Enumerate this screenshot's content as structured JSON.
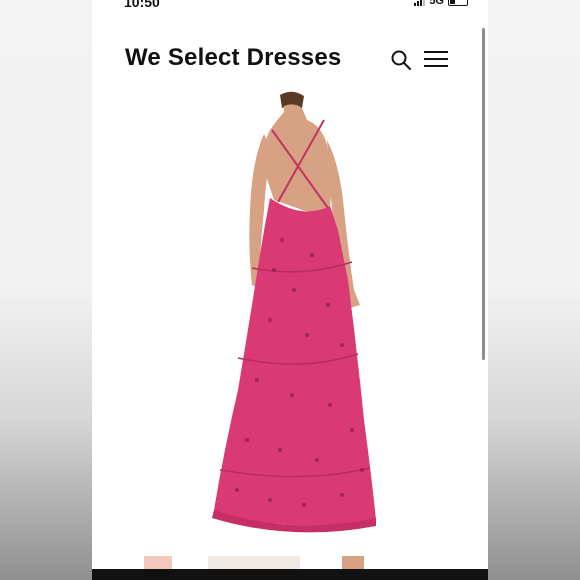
{
  "status_bar": {
    "time": "10:50",
    "network": "5G"
  },
  "header": {
    "title": "We Select Dresses",
    "search_icon": "search-icon",
    "menu_icon": "hamburger-menu-icon"
  },
  "product": {
    "image": "dress-image",
    "dress_color": "#d93a73"
  },
  "colors": {
    "background": "#ffffff",
    "text": "#111111",
    "accent": "#d93a73"
  }
}
